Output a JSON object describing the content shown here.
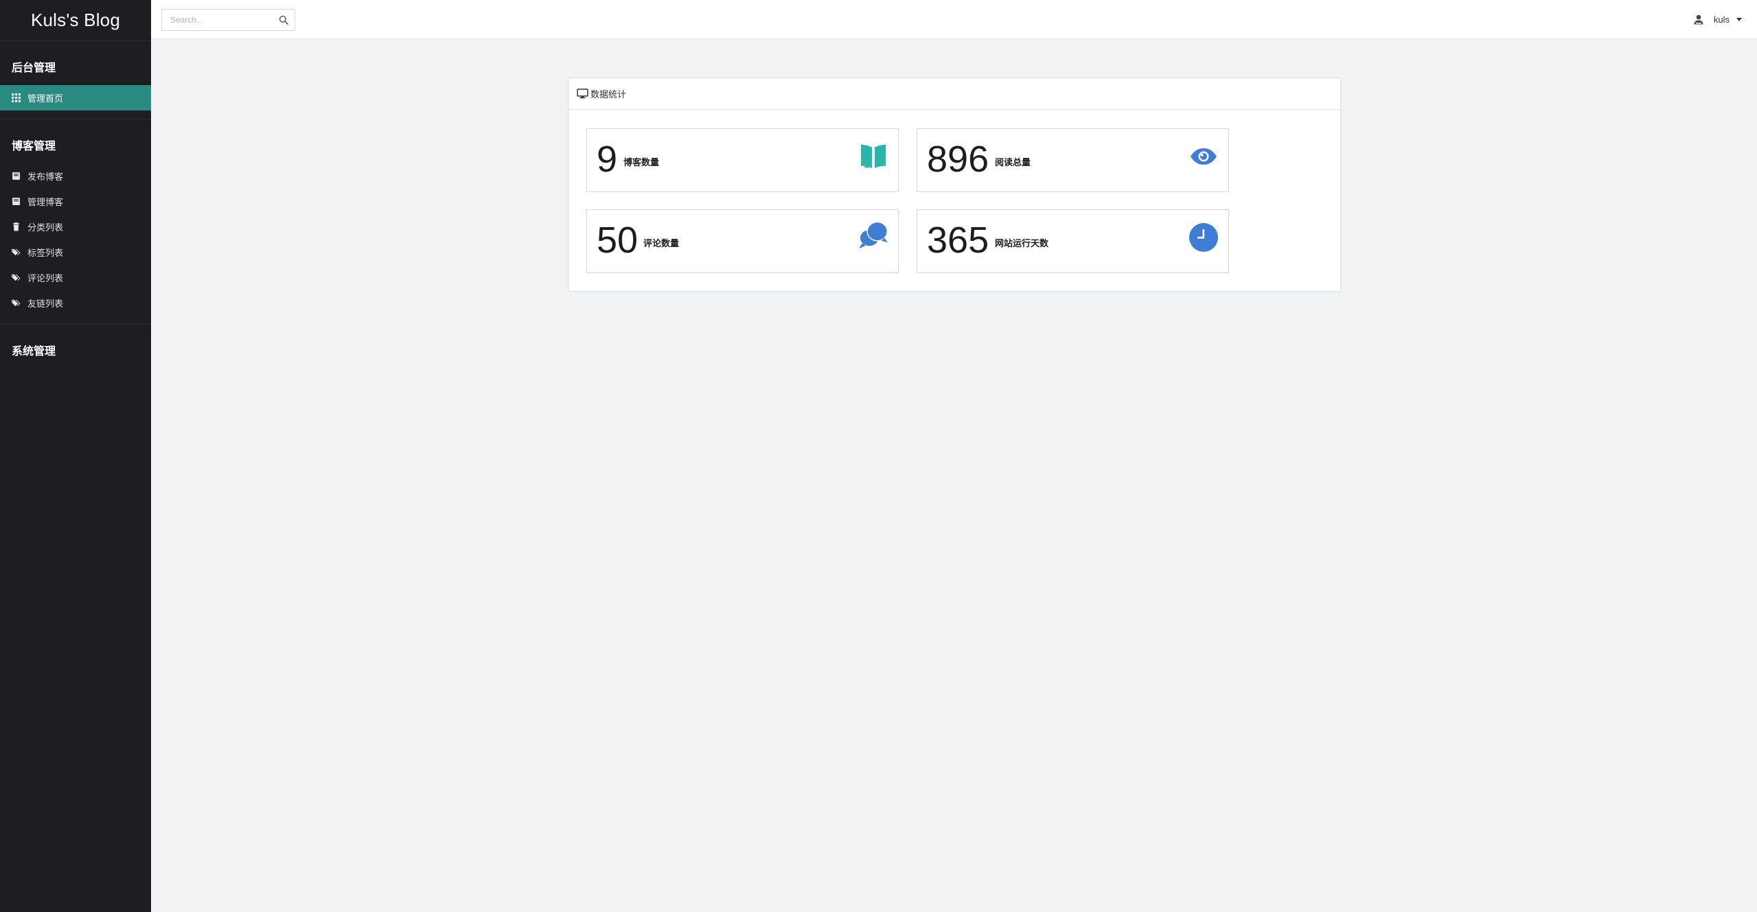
{
  "brand": {
    "title": "Kuls's Blog"
  },
  "sidebar": {
    "sections": [
      {
        "title": "后台管理",
        "items": [
          {
            "label": "管理首页",
            "icon": "grid-icon",
            "active": true
          }
        ]
      },
      {
        "title": "博客管理",
        "items": [
          {
            "label": "发布博客",
            "icon": "book-icon"
          },
          {
            "label": "管理博客",
            "icon": "book-icon"
          },
          {
            "label": "分类列表",
            "icon": "trash-icon"
          },
          {
            "label": "标签列表",
            "icon": "tags-icon"
          },
          {
            "label": "评论列表",
            "icon": "tags-icon"
          },
          {
            "label": "友链列表",
            "icon": "tags-icon"
          }
        ]
      },
      {
        "title": "系统管理",
        "items": []
      }
    ]
  },
  "topbar": {
    "search": {
      "placeholder": "Search..."
    },
    "user": {
      "name": "kuls"
    }
  },
  "panel": {
    "title": "数据统计",
    "stats": [
      {
        "value": "9",
        "label": "博客数量",
        "icon": "open-book-icon",
        "color": "#2ab7a9"
      },
      {
        "value": "896",
        "label": "阅读总量",
        "icon": "eye-icon",
        "color": "#3f7ed4"
      },
      {
        "value": "50",
        "label": "评论数量",
        "icon": "chat-bubbles-icon",
        "color": "#3f7ed4"
      },
      {
        "value": "365",
        "label": "网站运行天数",
        "icon": "clock-icon",
        "color": "#3f7ed4"
      }
    ]
  },
  "colors": {
    "sidebar_bg": "#1c1e21",
    "active_item": "#2a8a82",
    "page_bg": "#f1f2f4",
    "teal_accent": "#2ab7a9",
    "blue_accent": "#3f7ed4"
  }
}
